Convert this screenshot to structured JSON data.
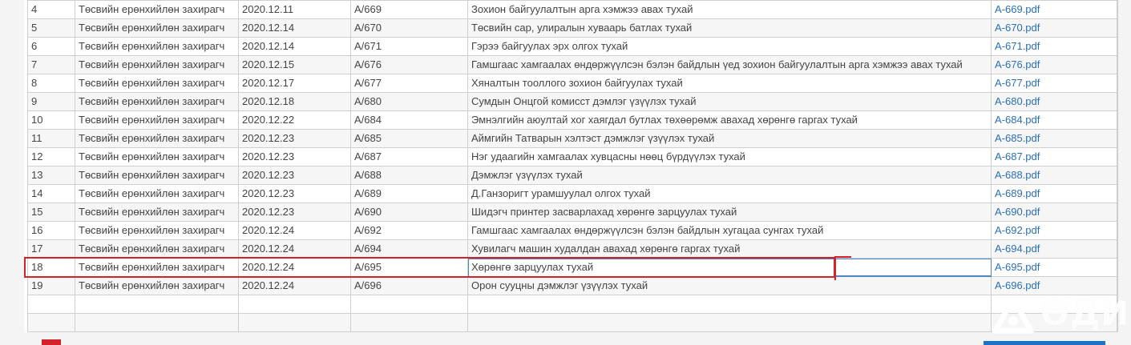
{
  "table": {
    "rows": [
      {
        "no": "4",
        "author": "Төсвийн ерөнхийлөн захирагч",
        "date": "2020.12.11",
        "code": "А/669",
        "title": "Зохион байгуулалтын арга хэмжээ авах тухай",
        "file": "A-669.pdf"
      },
      {
        "no": "5",
        "author": "Төсвийн ерөнхийлөн захирагч",
        "date": "2020.12.14",
        "code": "А/670",
        "title": "Төсвийн сар, улиралын хуваарь батлах тухай",
        "file": "A-670.pdf"
      },
      {
        "no": "6",
        "author": "Төсвийн ерөнхийлөн захирагч",
        "date": "2020.12.14",
        "code": "А/671",
        "title": "Гэрээ байгуулах эрх олгох тухай",
        "file": "A-671.pdf"
      },
      {
        "no": "7",
        "author": "Төсвийн ерөнхийлөн захирагч",
        "date": "2020.12.15",
        "code": "А/676",
        "title": "Гамшгаас хамгаалах өндөржүүлсэн бэлэн байдлын үед зохион байгуулалтын арга хэмжээ авах тухай",
        "file": "A-676.pdf"
      },
      {
        "no": "8",
        "author": "Төсвийн ерөнхийлөн захирагч",
        "date": "2020.12.17",
        "code": "А/677",
        "title": "Хяналтын тооллого зохион байгуулах тухай",
        "file": "A-677.pdf"
      },
      {
        "no": "9",
        "author": "Төсвийн ерөнхийлөн захирагч",
        "date": "2020.12.18",
        "code": "А/680",
        "title": "Сумдын Онцгой комисст дэмлэг үзүүлэх тухай",
        "file": "A-680.pdf"
      },
      {
        "no": "10",
        "author": "Төсвийн ерөнхийлөн захирагч",
        "date": "2020.12.22",
        "code": "А/684",
        "title": "Эмнэлгийн аюултай хог хаягдал бутлах төхөөрөмж авахад хөрөнгө гаргах тухай",
        "file": "A-684.pdf"
      },
      {
        "no": "11",
        "author": "Төсвийн ерөнхийлөн захирагч",
        "date": "2020.12.23",
        "code": "А/685",
        "title": "Аймгийн Татварын хэлтэст дэмжлэг үзүүлэх тухай",
        "file": "A-685.pdf"
      },
      {
        "no": "12",
        "author": "Төсвийн ерөнхийлөн захирагч",
        "date": "2020.12.23",
        "code": "А/687",
        "title": "Нэг удаагийн хамгаалах хувцасны нөөц бүрдүүлэх тухай",
        "file": "A-687.pdf"
      },
      {
        "no": "13",
        "author": "Төсвийн ерөнхийлөн захирагч",
        "date": "2020.12.23",
        "code": "А/688",
        "title": "Дэмжлэг үзүүлэх тухай",
        "file": "A-688.pdf"
      },
      {
        "no": "14",
        "author": "Төсвийн ерөнхийлөн захирагч",
        "date": "2020.12.23",
        "code": "А/689",
        "title": "Д.Ганзоригт урамшуулал олгох тухай",
        "file": "A-689.pdf"
      },
      {
        "no": "15",
        "author": "Төсвийн ерөнхийлөн захирагч",
        "date": "2020.12.23",
        "code": "А/690",
        "title": "Шидэгч принтер засварлахад хөрөнгө зарцуулах тухай",
        "file": "A-690.pdf"
      },
      {
        "no": "16",
        "author": "Төсвийн ерөнхийлөн захирагч",
        "date": "2020.12.24",
        "code": "А/692",
        "title": "Гамшгаас хамгаалах өндөржүүлсэн бэлэн байдлын хугацаа сунгах тухай",
        "file": "A-692.pdf"
      },
      {
        "no": "17",
        "author": "Төсвийн ерөнхийлөн захирагч",
        "date": "2020.12.24",
        "code": "А/694",
        "title": "Хувилагч машин худалдан авахад хөрөнгө гаргах тухай",
        "file": "A-694.pdf"
      },
      {
        "no": "18",
        "author": "Төсвийн ерөнхийлөн захирагч",
        "date": "2020.12.24",
        "code": "А/695",
        "title": "Хөрөнгө зарцуулах тухай",
        "file": "A-695.pdf"
      },
      {
        "no": "19",
        "author": "Төсвийн ерөнхийлөн захирагч",
        "date": "2020.12.24",
        "code": "А/696",
        "title": "Орон сууцны дэмжлэг үзүүлэх тухай",
        "file": "A-696.pdf"
      }
    ],
    "selected_row_no": "18"
  },
  "colors": {
    "link": "#2a6fb7",
    "highlight": "#d6202a",
    "selection": "#4a86c8"
  },
  "watermark": {
    "text": "ӨДИМ",
    "icon": "watermark-logo-icon"
  }
}
